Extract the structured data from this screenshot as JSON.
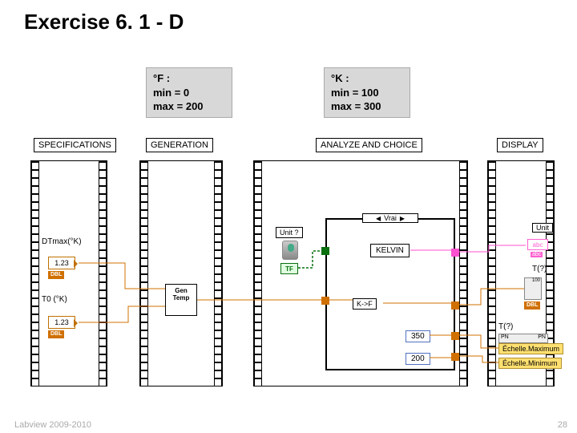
{
  "title": "Exercise 6. 1 - D",
  "specF": {
    "line1": "°F :",
    "line2": "min = 0",
    "line3": "max = 200"
  },
  "specK": {
    "line1": "°K :",
    "line2": "min = 100",
    "line3": "max = 300"
  },
  "sections": {
    "spec": "SPECIFICATIONS",
    "gen": "GENERATION",
    "analyze": "ANALYZE AND CHOICE",
    "display": "DISPLAY"
  },
  "controls": {
    "dtmax": "DTmax(°K)",
    "t0": "T0 (°K)",
    "numDisplay": "1.23",
    "dbl": "DBL"
  },
  "gen": {
    "subvi1": "Gen",
    "subvi2": "Temp"
  },
  "analyze": {
    "unitq": "Unit ?",
    "caseTrue": "Vrai",
    "kelvin": "KELVIN",
    "tf": "TF",
    "ktof": "K->F"
  },
  "display": {
    "unit": "Unit",
    "abc": "abc",
    "abcTag": "abc",
    "tq": "T(?)",
    "thermoTop": "100",
    "echelleMax": "Échelle.Maximum",
    "echelleMin": "Échelle.Minimum",
    "pn": "PN"
  },
  "consts": {
    "c350": "350",
    "c200": "200"
  },
  "footer": "Labview 2009-2010",
  "pagenum": "28"
}
